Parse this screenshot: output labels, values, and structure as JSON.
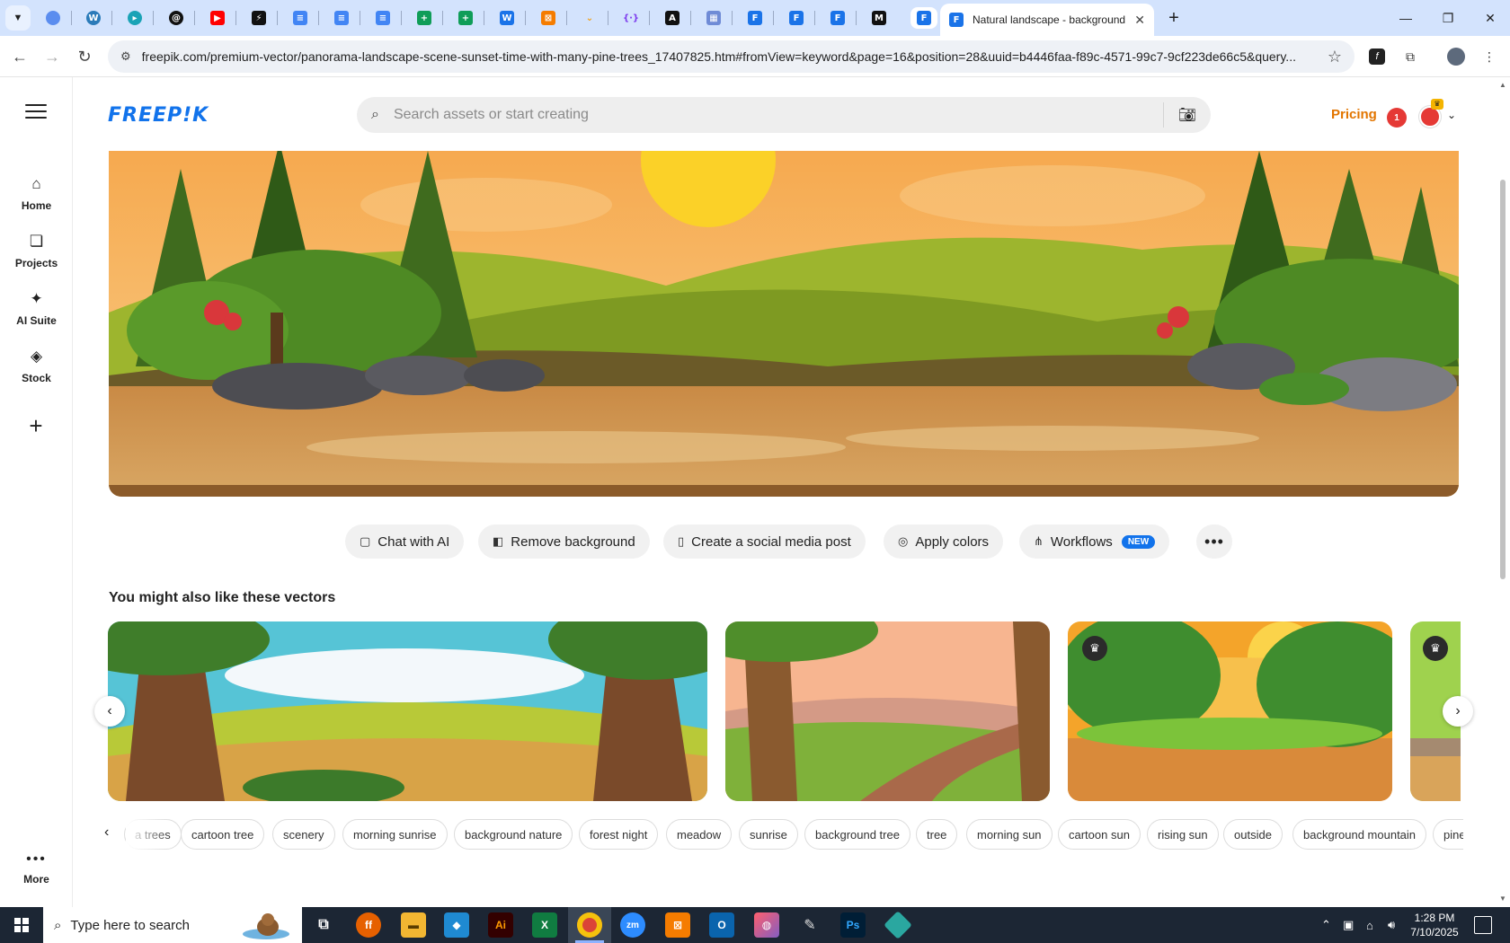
{
  "browser": {
    "active_tab_title": "Natural landscape - background",
    "url": "freepik.com/premium-vector/panorama-landscape-scene-sunset-time-with-many-pine-trees_17407825.htm#fromView=keyword&page=16&position=28&uuid=b4446faa-f89c-4571-99c7-9cf223de66c5&query...",
    "close_symbol": "✕",
    "new_tab_symbol": "+"
  },
  "sidebar": {
    "items": [
      {
        "label": "Home",
        "icon": "home-icon"
      },
      {
        "label": "Projects",
        "icon": "projects-icon"
      },
      {
        "label": "AI Suite",
        "icon": "sparkle-icon"
      },
      {
        "label": "Stock",
        "icon": "stock-icon"
      }
    ],
    "more_label": "More"
  },
  "header": {
    "logo_text": "FREEP!K",
    "search_placeholder": "Search assets or start creating",
    "pricing_label": "Pricing",
    "notification_count": "1"
  },
  "actions": [
    {
      "label": "Chat with AI",
      "icon": "chat-icon"
    },
    {
      "label": "Remove background",
      "icon": "remove-bg-icon"
    },
    {
      "label": "Create a social media post",
      "icon": "phone-icon"
    },
    {
      "label": "Apply colors",
      "icon": "palette-icon"
    },
    {
      "label": "Workflows",
      "icon": "workflow-icon",
      "badge": "NEW"
    }
  ],
  "section_title": "You might also like these vectors",
  "tags": [
    "a trees",
    "cartoon tree",
    "scenery",
    "morning sunrise",
    "background nature",
    "forest night",
    "meadow",
    "sunrise",
    "background tree",
    "tree",
    "morning sun",
    "cartoon sun",
    "rising sun",
    "outside",
    "background mountain",
    "pine"
  ],
  "taskbar": {
    "search_text": "Type here to search",
    "time": "1:28 PM",
    "date": "7/10/2025"
  },
  "colors": {
    "brand": "#1273eb",
    "pricing": "#e27500",
    "tab_strip": "#d3e3fd",
    "taskbar": "#1c2634"
  }
}
